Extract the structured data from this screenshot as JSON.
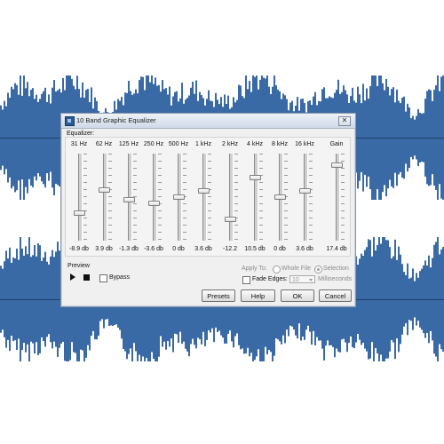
{
  "window": {
    "title": "10 Band Graphic Equalizer",
    "close_glyph": "✕"
  },
  "equalizer": {
    "label": "Equalizer:",
    "bands": [
      {
        "freq": "31 Hz",
        "value_label": "-8.9 db",
        "level": -8.9
      },
      {
        "freq": "62 Hz",
        "value_label": "3.9 db",
        "level": 3.9
      },
      {
        "freq": "125 Hz",
        "value_label": "-1.3 db",
        "level": -1.3
      },
      {
        "freq": "250 Hz",
        "value_label": "-3.6 db",
        "level": -3.6
      },
      {
        "freq": "500 Hz",
        "value_label": "0 db",
        "level": 0
      },
      {
        "freq": "1 kHz",
        "value_label": "3.6 db",
        "level": 3.6
      },
      {
        "freq": "2 kHz",
        "value_label": "-12.2",
        "level": -12.2
      },
      {
        "freq": "4 kHz",
        "value_label": "10.5 db",
        "level": 10.5
      },
      {
        "freq": "8 kHz",
        "value_label": "0 db",
        "level": 0
      },
      {
        "freq": "16 kHz",
        "value_label": "3.6 db",
        "level": 3.6
      },
      {
        "freq": "Gain",
        "value_label": "17.4 db",
        "level": 17.4
      }
    ]
  },
  "preview": {
    "label": "Preview",
    "bypass_label": "Bypass",
    "bypass_checked": false
  },
  "apply_to": {
    "label": "Apply To:",
    "option_whole": "Whole File",
    "option_selection": "Selection",
    "selected": "Selection"
  },
  "fade": {
    "label": "Fade Edges:",
    "checked": false,
    "value": "10",
    "unit": "Milliseconds"
  },
  "buttons": {
    "presets": "Presets",
    "help": "Help",
    "ok": "OK",
    "cancel": "Cancel"
  },
  "colors": {
    "waveform": "#3a6aa5",
    "background": "#ffffff"
  }
}
